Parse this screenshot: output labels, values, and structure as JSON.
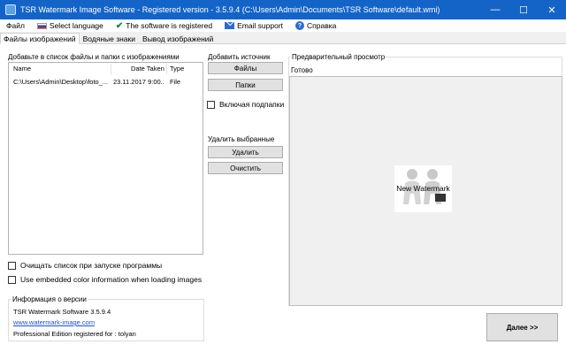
{
  "window": {
    "title": "TSR Watermark Image Software - Registered version - 3.5.9.4 (C:\\Users\\Admin\\Documents\\TSR Software\\default.wmi)",
    "minimize": "—",
    "maximize": "☐",
    "close": "✕"
  },
  "menu": {
    "file": "Файл",
    "select_language": "Select language",
    "registered": "The software is registered",
    "email_support": "Email support",
    "help": "Справка"
  },
  "tabs": [
    "Файлы изображений",
    "Водяные знаки",
    "Вывод изображений"
  ],
  "files": {
    "header": "Добавьте в список файлы и папки с изображениями",
    "columns": {
      "name": "Name",
      "date": "Date Taken",
      "type": "Type"
    },
    "rows": [
      {
        "name": "C:\\Users\\Admin\\Desktop\\foto_...",
        "date": "23.11.2017 9:00...",
        "type": "File"
      }
    ],
    "clear_on_start": "Очищать список при запуске программы",
    "embedded_color": "Use embedded color information when loading images"
  },
  "add_source": {
    "label": "Добавить источник",
    "files_btn": "Файлы",
    "folders_btn": "Папки",
    "include_subfolders": "Включая подпапки"
  },
  "remove": {
    "label": "Удалить выбранные",
    "delete_btn": "Удалить",
    "clear_btn": "Очистить"
  },
  "preview": {
    "label": "Предварительный просмотр",
    "status": "Готово",
    "watermark_text": "New Watermark"
  },
  "version": {
    "label": "Информация о версии",
    "product": "TSR Watermark Software 3.5.9.4",
    "website": "www.watermark-image.com",
    "edition": "Professional Edition registered for : tolyan"
  },
  "next_btn": "Далее >>"
}
